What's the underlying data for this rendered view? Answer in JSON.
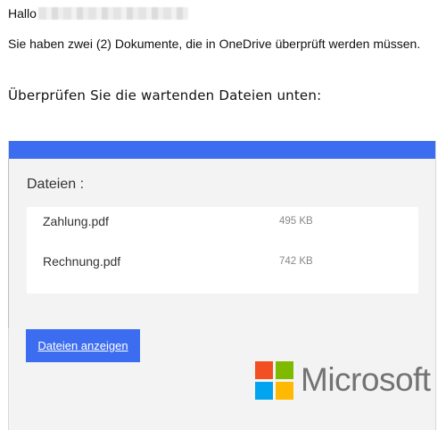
{
  "greeting": {
    "text": "Hallo"
  },
  "message": {
    "line1": "Sie haben zwei (2) Dokumente, die in OneDrive überprüft werden müssen.",
    "line2": "Überprüfen Sie die wartenden Dateien unten:"
  },
  "card": {
    "title": "Dateien :",
    "files": [
      {
        "name": "Zahlung.pdf",
        "size": "495 KB"
      },
      {
        "name": "Rechnung.pdf",
        "size": "742 KB"
      }
    ],
    "button_label": "Dateien anzeigen"
  },
  "brand": {
    "name": "Microsoft",
    "logo_colors": [
      "#f25022",
      "#7fba00",
      "#00a4ef",
      "#ffb900"
    ]
  },
  "colors": {
    "accent": "#3c6df0"
  }
}
